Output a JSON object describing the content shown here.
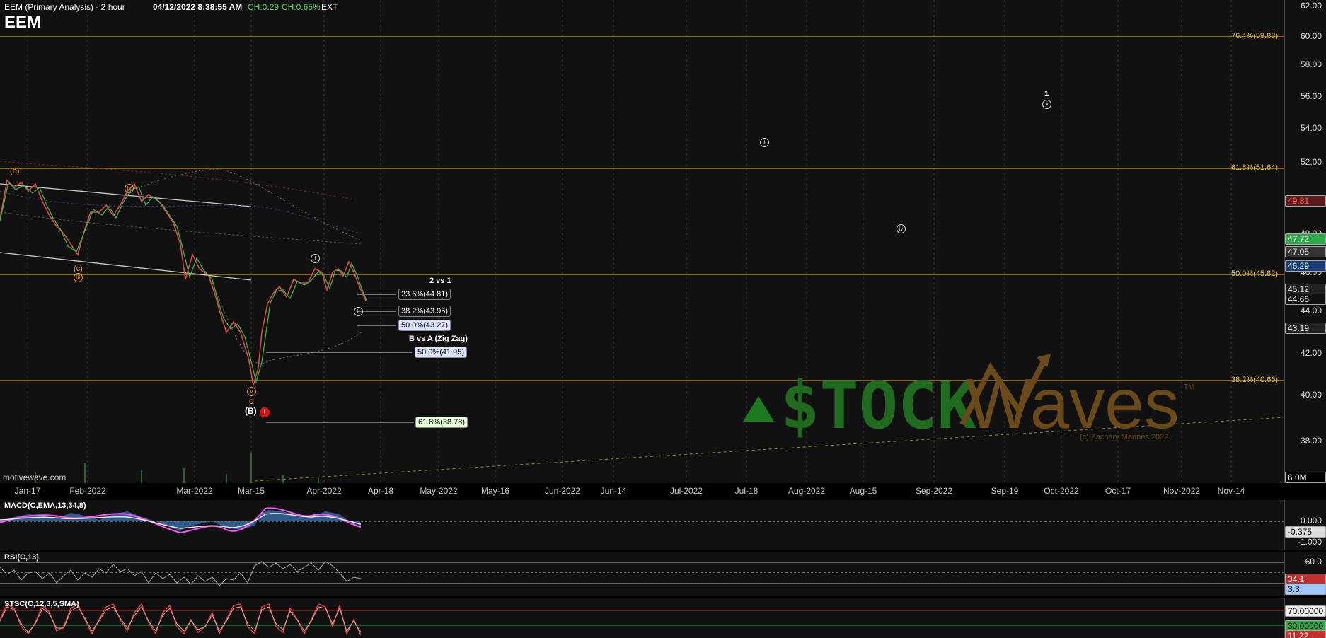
{
  "header": {
    "title": "EEM (Primary Analysis) - 2 hour",
    "timestamp": "04/12/2022 8:38:55 AM",
    "change": "CH:0.29",
    "change_pct": "CH:0.65%",
    "session": "EXT",
    "symbol": "EEM"
  },
  "price_axis": {
    "labels": [
      "62.00",
      "60.00",
      "58.00",
      "56.00",
      "54.00",
      "52.00",
      "48.00",
      "46.00",
      "44.00",
      "42.00",
      "40.00",
      "38.00"
    ],
    "volume_label": "6.0M"
  },
  "price_tags": [
    {
      "value": "49.81",
      "color": "#c03030"
    },
    {
      "value": "47.72",
      "color": "#2fa84a"
    },
    {
      "value": "47.05",
      "color": "#444"
    },
    {
      "value": "46.29",
      "color": "#3070c0"
    },
    {
      "value": "45.12",
      "color": "#333"
    },
    {
      "value": "44.66",
      "color": "#222"
    },
    {
      "value": "43.19",
      "color": "#333"
    }
  ],
  "fib_levels": [
    {
      "label": "76.4%(59.88)"
    },
    {
      "label": "61.8%(51.64)"
    },
    {
      "label": "50.0%(45.82)"
    },
    {
      "label": "38.2%(40.66)"
    }
  ],
  "fib_boxes": [
    {
      "label": "23.6%(44.81)",
      "bg": "#111",
      "fg": "#fff"
    },
    {
      "label": "38.2%(43.95)",
      "bg": "#111",
      "fg": "#fff"
    },
    {
      "label": "50.0%(43.27)",
      "bg": "#dde4ff",
      "fg": "#000"
    },
    {
      "label": "50.0%(41.95)",
      "bg": "#dde4ff",
      "fg": "#000"
    },
    {
      "label": "61.8%(38.78)",
      "bg": "#e7ffd9",
      "fg": "#000"
    }
  ],
  "annotations": {
    "two_vs_one": "2 vs 1",
    "b_vs_a": "B vs A (Zig Zag)",
    "wave_b": "(B)",
    "wave_c": "c",
    "wave_b_small": "(b)",
    "wave_c_small": "(c)",
    "wave_iii": "iii",
    "wave_iv": "iv",
    "wave_v": "v",
    "wave_i": "i",
    "wave_ii": "ii",
    "future_iii": "iii",
    "future_iv": "iv",
    "future_v": "v",
    "future_one": "1",
    "alert": "!"
  },
  "watermark": {
    "stock": "$TOCK",
    "waves": "Waves",
    "tm": "TM",
    "credit": "(c) Zachary Mannes 2022",
    "site": "motivewave.com"
  },
  "date_axis": [
    "Jan-17",
    "Feb-2022",
    "Mar-2022",
    "Mar-15",
    "Apr-2022",
    "Apr-18",
    "May-2022",
    "May-16",
    "Jun-2022",
    "Jun-14",
    "Jul-2022",
    "Jul-18",
    "Aug-2022",
    "Aug-15",
    "Sep-2022",
    "Sep-19",
    "Oct-2022",
    "Oct-17",
    "Nov-2022",
    "Nov-14"
  ],
  "macd": {
    "title": "MACD(C,EMA,13,34,8)",
    "axis": [
      "0.000",
      "-1.000"
    ],
    "tag": "-0.375"
  },
  "rsi": {
    "title": "RSI(C,13)",
    "axis": [
      "60.0"
    ],
    "tags": [
      "34.1",
      "3.3"
    ]
  },
  "stsc": {
    "title": "STSC(C,12,3,5,SMA)",
    "tags": [
      "70.00000",
      "30.00000",
      "11.22"
    ]
  }
}
